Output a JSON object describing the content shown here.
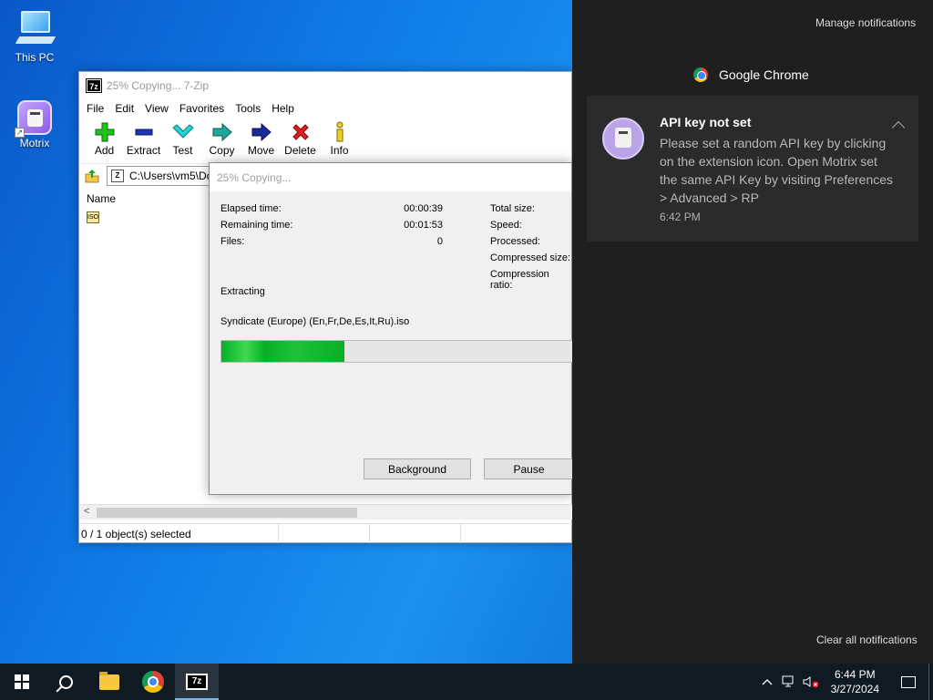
{
  "desktop": {
    "icons": [
      {
        "label": "This PC"
      },
      {
        "label": "Motrix"
      }
    ]
  },
  "zip_window": {
    "title": "25% Copying... 7-Zip",
    "menu": [
      "File",
      "Edit",
      "View",
      "Favorites",
      "Tools",
      "Help"
    ],
    "toolbar": [
      {
        "label": "Add",
        "icon": "plus-icon"
      },
      {
        "label": "Extract",
        "icon": "minus-icon"
      },
      {
        "label": "Test",
        "icon": "check-icon"
      },
      {
        "label": "Copy",
        "icon": "copy-arrow-icon"
      },
      {
        "label": "Move",
        "icon": "move-arrow-icon"
      },
      {
        "label": "Delete",
        "icon": "x-icon"
      },
      {
        "label": "Info",
        "icon": "info-icon"
      }
    ],
    "address": "C:\\Users\\vm5\\Dc",
    "column_name": "Name",
    "status": "0 / 1 object(s) selected"
  },
  "progress_dialog": {
    "title": "25% Copying...",
    "left_stats": [
      {
        "label": "Elapsed time:",
        "value": "00:00:39"
      },
      {
        "label": "Remaining time:",
        "value": "00:01:53"
      },
      {
        "label": "Files:",
        "value": "0"
      }
    ],
    "right_stats": [
      "Total size:",
      "Speed:",
      "Processed:",
      "Compressed size:",
      "Compression ratio:"
    ],
    "operation": "Extracting",
    "file": "Syndicate (Europe) (En,Fr,De,Es,It,Ru).iso",
    "progress_percent": 25,
    "buttons": {
      "background": "Background",
      "pause": "Pause"
    }
  },
  "action_center": {
    "manage": "Manage notifications",
    "app_name": "Google Chrome",
    "toast": {
      "title": "API key not set",
      "body": "Please set a random API key by clicking on the extension icon. Open Motrix set the same API Key by visiting Preferences > Advanced > RP",
      "time": "6:42 PM"
    },
    "clear_all": "Clear all notifications"
  },
  "taskbar": {
    "time": "6:44 PM",
    "date": "3/27/2024"
  },
  "colors": {
    "progress_fill": "#06b025",
    "action_center_bg": "#1f1f1f",
    "taskbar_bg": "#101a22"
  }
}
